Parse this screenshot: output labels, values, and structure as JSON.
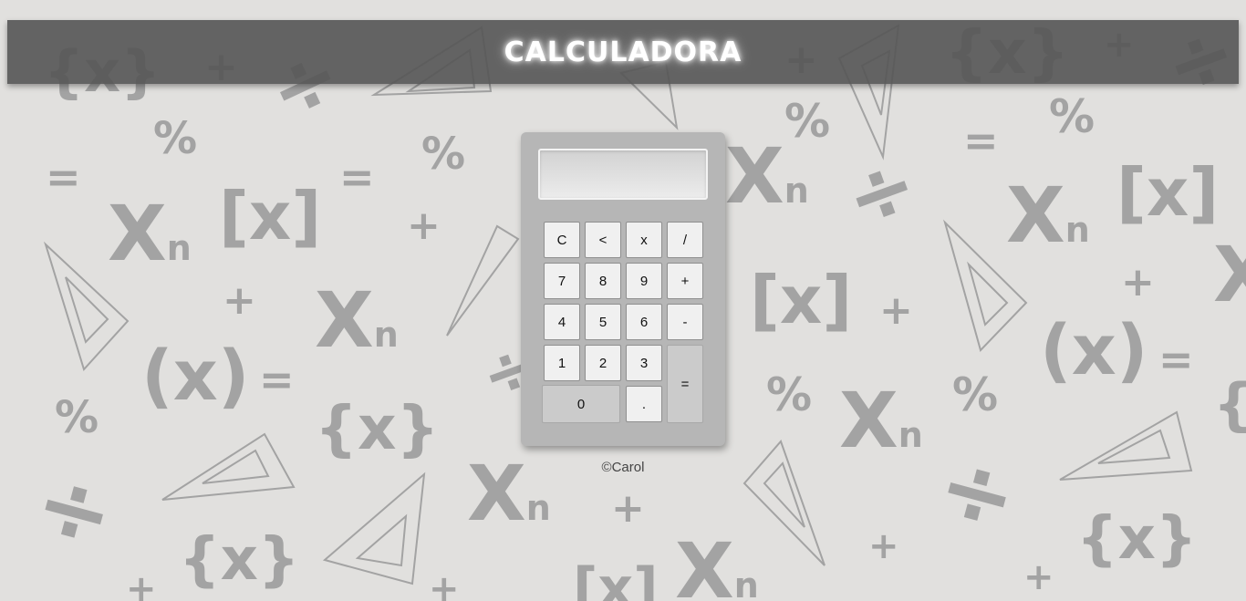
{
  "header": {
    "title": "CALCULADORA"
  },
  "display": {
    "value": ""
  },
  "keys": {
    "clear": "C",
    "backspace": "<",
    "multiply": "x",
    "divide": "/",
    "seven": "7",
    "eight": "8",
    "nine": "9",
    "plus": "+",
    "four": "4",
    "five": "5",
    "six": "6",
    "minus": "-",
    "one": "1",
    "two": "2",
    "three": "3",
    "equals": "=",
    "zero": "0",
    "decimal": "."
  },
  "footer": {
    "credit": "©Carol"
  },
  "background": {
    "icons": [
      "divide-symbol",
      "percent-symbol",
      "plus-symbol",
      "equals-symbol",
      "x-n-symbol",
      "bracket-x-symbol",
      "triangle-ruler"
    ]
  },
  "colors": {
    "background": "#e1e0de",
    "header": "#555555",
    "calculator_body": "#b6b6b6",
    "key": "#f0f0f0",
    "key_dark": "#cbcbcb"
  }
}
